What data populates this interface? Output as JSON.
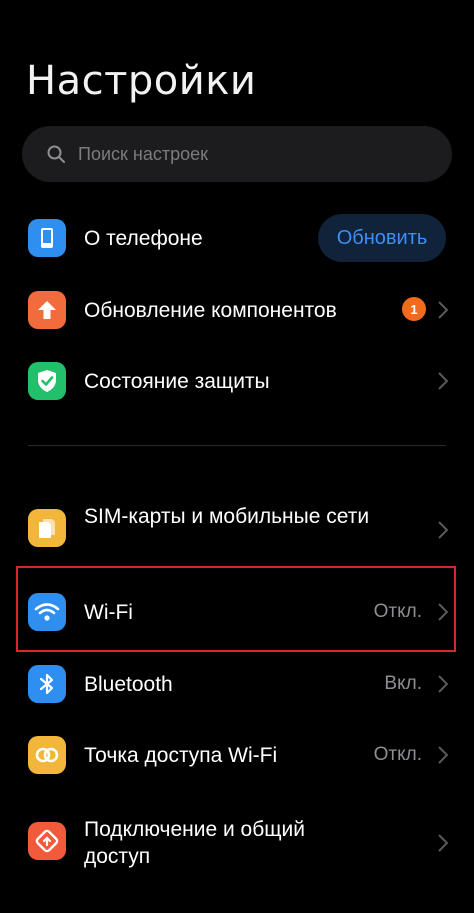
{
  "header": {
    "title": "Настройки"
  },
  "search": {
    "placeholder": "Поиск настроек"
  },
  "rows": [
    {
      "label": "О телефоне",
      "action_label": "Обновить",
      "icon": "phone-icon",
      "color": "#2f8ff0"
    },
    {
      "label": "Обновление компонентов",
      "badge": "1",
      "icon": "arrow-up-icon",
      "color": "#f26b3c"
    },
    {
      "label": "Состояние защиты",
      "icon": "shield-check-icon",
      "color": "#22c06a"
    },
    {
      "label": "SIM-карты и мобильные сети",
      "icon": "sim-card-icon",
      "color": "#f2b63a"
    },
    {
      "label": "Wi-Fi",
      "value": "Откл.",
      "icon": "wifi-icon",
      "color": "#2f8ff0"
    },
    {
      "label": "Bluetooth",
      "value": "Вкл.",
      "icon": "bluetooth-icon",
      "color": "#2f8ff0"
    },
    {
      "label": "Точка доступа Wi-Fi",
      "value": "Откл.",
      "icon": "hotspot-icon",
      "color": "#f2b63a"
    },
    {
      "label": "Подключение и общий доступ",
      "icon": "share-icon",
      "color": "#f25a3c"
    }
  ],
  "colors": {
    "accent": "#3d8ff5",
    "highlight": "#d9262b",
    "badge": "#f26b1d"
  }
}
